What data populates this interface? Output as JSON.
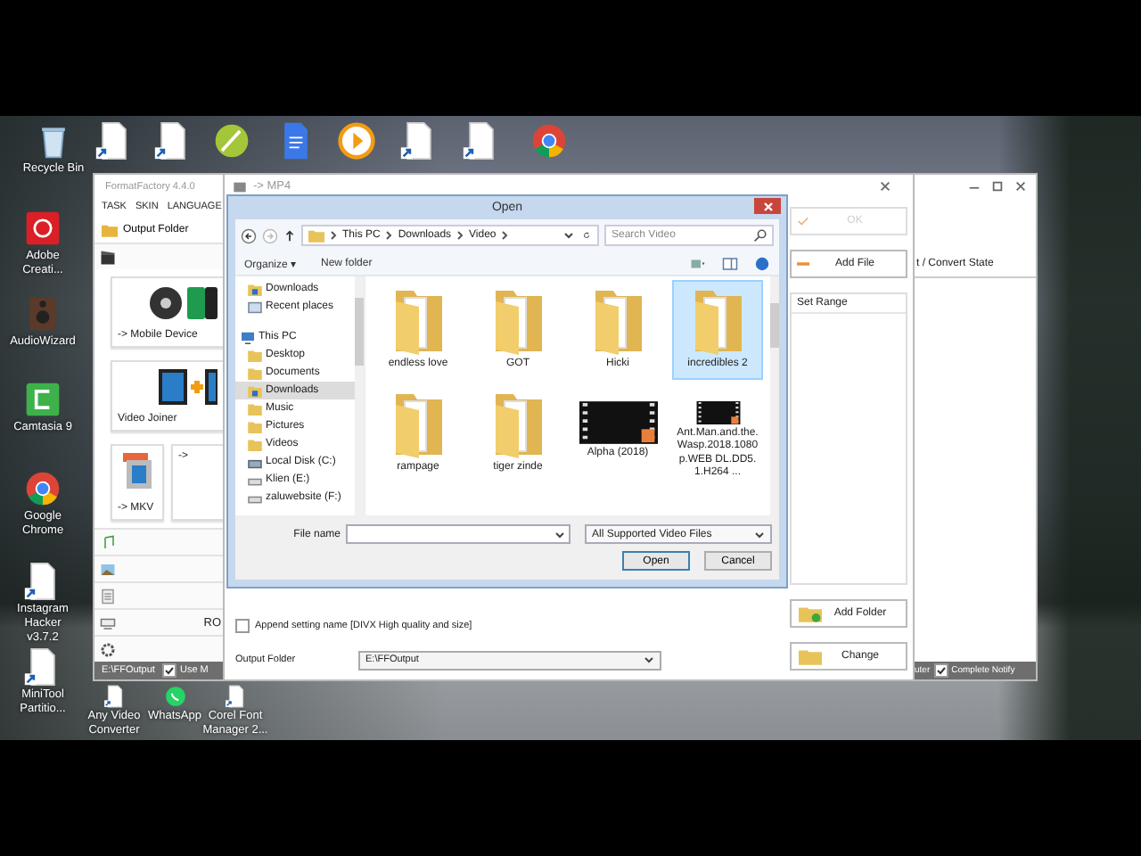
{
  "desktop": {
    "icons": [
      {
        "label": "Recycle Bin",
        "kind": "bin"
      },
      {
        "kind": "doc"
      },
      {
        "kind": "doc"
      },
      {
        "kind": "pen"
      },
      {
        "kind": "gdoc"
      },
      {
        "kind": "player"
      },
      {
        "kind": "doc"
      },
      {
        "kind": "doc"
      },
      {
        "kind": "chrome"
      },
      {
        "label": "Adobe Creati...",
        "kind": "adobe"
      },
      {
        "label": "AudioWizard",
        "kind": "audio"
      },
      {
        "label": "Camtasia 9",
        "kind": "camtasia"
      },
      {
        "label": "Google Chrome",
        "kind": "chrome"
      },
      {
        "label": "Instagram Hacker v3.7.2",
        "kind": "doc"
      },
      {
        "label": "MiniTool Partitio...",
        "kind": "doc"
      },
      {
        "label": "Any Video Converter",
        "kind": "doc"
      },
      {
        "label": "WhatsApp",
        "kind": "whatsapp"
      },
      {
        "label": "Corel Font Manager 2...",
        "kind": "doc"
      }
    ]
  },
  "format_factory": {
    "title": "FormatFactory 4.4.0",
    "menu": [
      "TASK",
      "SKIN",
      "LANGUAGE"
    ],
    "output_folder_button": "Output Folder",
    "video_category": {
      "kind": "video"
    },
    "tiles": [
      {
        "label": "-> Mobile Device",
        "kind": "mobile"
      },
      {
        "label": "Video Joiner",
        "kind": "joiner"
      },
      {
        "label": "-> MKV",
        "kind": "mkv"
      },
      {
        "label": "->",
        "kind": "blank"
      }
    ],
    "categories": [
      {
        "kind": "audio"
      },
      {
        "kind": "picture"
      },
      {
        "kind": "document"
      },
      {
        "kind": "rom",
        "label": "RO"
      },
      {
        "kind": "tools"
      }
    ],
    "status": {
      "output_path": "E:\\FFOutput",
      "option": {
        "label": "Use M",
        "checked": true
      }
    },
    "column_header": "t / Convert State",
    "status_right": {
      "text": "uter",
      "complete_notify": {
        "label": "Complete Notify",
        "checked": true
      }
    }
  },
  "mp4_dialog": {
    "title": "-> MP4",
    "buttons": [
      {
        "label": "OK",
        "kind": "ok",
        "disabled": true
      },
      {
        "label": "Add File",
        "kind": "add-file",
        "disabled": false
      }
    ],
    "range_list": {
      "header": "Set Range"
    },
    "folder_buttons": [
      {
        "label": "Add Folder",
        "kind": "add-folder"
      },
      {
        "label": "Change",
        "kind": "change"
      }
    ],
    "append_setting": {
      "label": "Append setting name [DIVX High quality and size]",
      "checked": false
    },
    "output_folder": {
      "label": "Output Folder",
      "value": "E:\\FFOutput"
    }
  },
  "open_dialog": {
    "title": "Open",
    "path": [
      "This PC",
      "Downloads",
      "Video"
    ],
    "search": {
      "placeholder": "Search Video"
    },
    "toolbar": {
      "organize": "Organize ▾",
      "new_folder": "New folder"
    },
    "nav_tree": [
      {
        "children": [
          {
            "label": "Downloads",
            "kind": "downloads",
            "selected": false
          },
          {
            "label": "Recent places",
            "kind": "recent",
            "selected": false
          }
        ]
      },
      {
        "label": "This PC",
        "kind": "pc",
        "selected": false,
        "children": [
          {
            "label": "Desktop",
            "kind": "folder",
            "selected": false
          },
          {
            "label": "Documents",
            "kind": "folder",
            "selected": false
          },
          {
            "label": "Downloads",
            "kind": "downloads",
            "selected": true
          },
          {
            "label": "Music",
            "kind": "folder",
            "selected": false
          },
          {
            "label": "Pictures",
            "kind": "folder",
            "selected": false
          },
          {
            "label": "Videos",
            "kind": "folder",
            "selected": false
          },
          {
            "label": "Local Disk (C:)",
            "kind": "disk",
            "selected": false
          },
          {
            "label": "Klien (E:)",
            "kind": "drive",
            "selected": false
          },
          {
            "label": "zaluwebsite (F:)",
            "kind": "drive",
            "selected": false
          }
        ]
      }
    ],
    "items": [
      {
        "label": "endless love",
        "kind": "folder",
        "selected": false
      },
      {
        "label": "GOT",
        "kind": "folder",
        "selected": false
      },
      {
        "label": "Hicki",
        "kind": "folder",
        "selected": false
      },
      {
        "label": "incredibles 2",
        "kind": "folder",
        "selected": true
      },
      {
        "label": "rampage",
        "kind": "folder",
        "selected": false
      },
      {
        "label": "tiger zinde",
        "kind": "folder",
        "selected": false
      },
      {
        "label": "Alpha (2018)",
        "kind": "video",
        "selected": false
      },
      {
        "label": "Ant.Man.and.the.Wasp.2018.1080p.WEB DL.DD5.1.H264 ...",
        "kind": "video",
        "selected": false
      }
    ],
    "file_name": {
      "label": "File name"
    },
    "file_type": "All Supported Video Files",
    "buttons": [
      "Open",
      "Cancel"
    ]
  }
}
